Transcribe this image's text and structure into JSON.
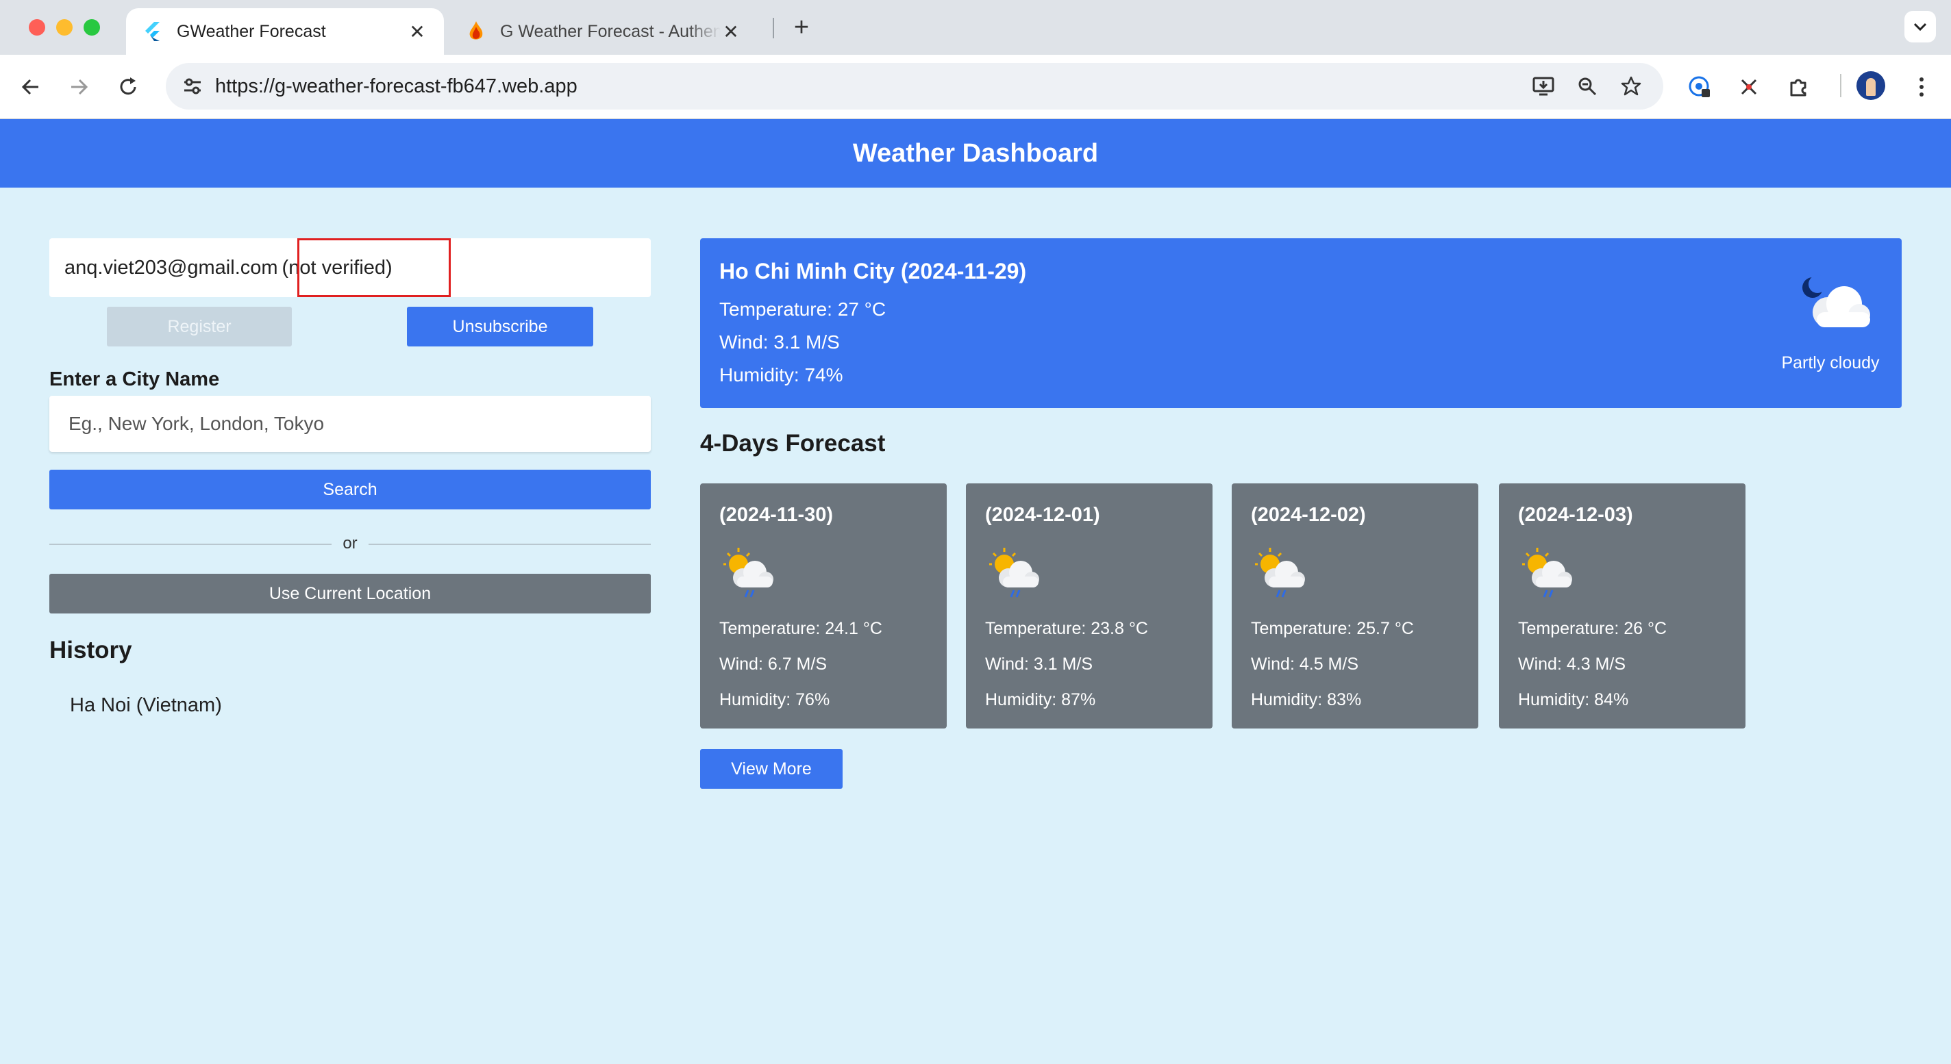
{
  "browser": {
    "tabs": [
      {
        "title": "GWeather Forecast",
        "active": true
      },
      {
        "title": "G Weather Forecast - Authenti",
        "active": false
      }
    ],
    "url": "https://g-weather-forecast-fb647.web.app"
  },
  "header": {
    "title": "Weather Dashboard"
  },
  "account": {
    "email": "anq.viet203@gmail.com",
    "status": "(not verified)",
    "register_label": "Register",
    "unsubscribe_label": "Unsubscribe"
  },
  "search": {
    "label": "Enter a City Name",
    "placeholder": "Eg., New York, London, Tokyo",
    "button_label": "Search",
    "divider_text": "or",
    "location_button_label": "Use Current Location"
  },
  "history": {
    "title": "History",
    "items": [
      "Ha Noi (Vietnam)"
    ]
  },
  "current": {
    "title": "Ho Chi Minh City (2024-11-29)",
    "temperature": "Temperature: 27 °C",
    "wind": "Wind: 3.1 M/S",
    "humidity": "Humidity: 74%",
    "condition": "Partly cloudy",
    "icon": "night-partly-cloudy-icon"
  },
  "forecast": {
    "title": "4-Days Forecast",
    "days": [
      {
        "date": "(2024-11-30)",
        "temperature": "Temperature: 24.1 °C",
        "wind": "Wind: 6.7 M/S",
        "humidity": "Humidity: 76%",
        "icon": "sun-cloud-rain-icon"
      },
      {
        "date": "(2024-12-01)",
        "temperature": "Temperature: 23.8 °C",
        "wind": "Wind: 3.1 M/S",
        "humidity": "Humidity: 87%",
        "icon": "sun-cloud-rain-icon"
      },
      {
        "date": "(2024-12-02)",
        "temperature": "Temperature: 25.7 °C",
        "wind": "Wind: 4.5 M/S",
        "humidity": "Humidity: 83%",
        "icon": "sun-cloud-rain-icon"
      },
      {
        "date": "(2024-12-03)",
        "temperature": "Temperature: 26 °C",
        "wind": "Wind: 4.3 M/S",
        "humidity": "Humidity: 84%",
        "icon": "sun-cloud-rain-icon"
      }
    ],
    "view_more_label": "View More"
  },
  "colors": {
    "primary": "#3a75ef",
    "secondary": "#6c757d",
    "page_background": "#dcf1fa",
    "highlight_box": "#e02020"
  }
}
